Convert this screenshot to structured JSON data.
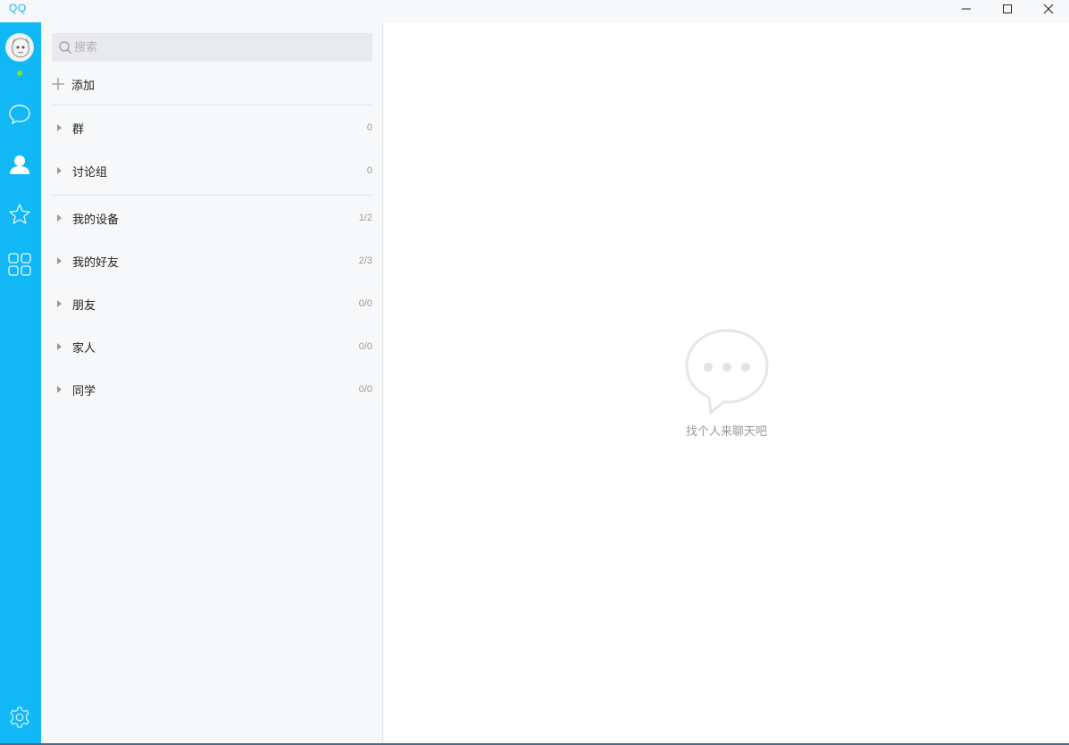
{
  "window": {
    "title": "QQ"
  },
  "search": {
    "placeholder": "搜索"
  },
  "add": {
    "label": "添加"
  },
  "groups_top": [
    {
      "label": "群",
      "count": "0"
    },
    {
      "label": "讨论组",
      "count": "0"
    }
  ],
  "groups_contacts": [
    {
      "label": "我的设备",
      "count": "1/2"
    },
    {
      "label": "我的好友",
      "count": "2/3"
    },
    {
      "label": "朋友",
      "count": "0/0"
    },
    {
      "label": "家人",
      "count": "0/0"
    },
    {
      "label": "同学",
      "count": "0/0"
    }
  ],
  "main": {
    "empty_text": "找个人来聊天吧"
  },
  "colors": {
    "accent": "#12b7f5",
    "online": "#8ce02c"
  },
  "icons": [
    "chat-bubble-icon",
    "contacts-icon",
    "star-icon",
    "apps-grid-icon",
    "settings-gear-icon"
  ]
}
